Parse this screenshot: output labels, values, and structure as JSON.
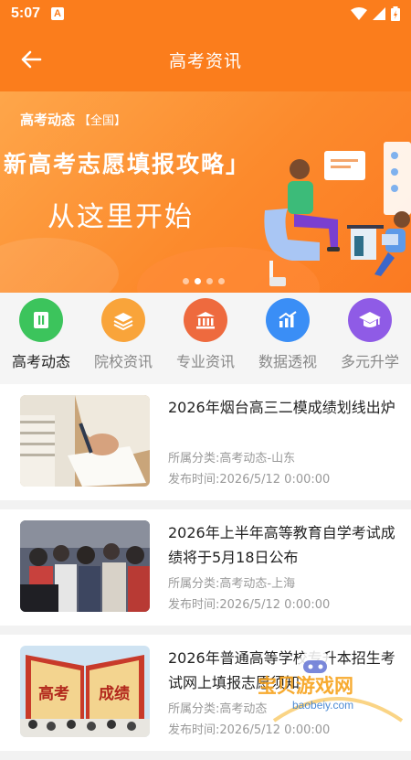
{
  "status_bar": {
    "time": "5:07",
    "badge": "A"
  },
  "header": {
    "title": "高考资讯"
  },
  "banner": {
    "tag": "高考动态",
    "tag_sub": "【全国】",
    "line1": "新高考志愿填报攻略」",
    "line2": "从这里开始",
    "slide_count": 4,
    "active_slide": 1
  },
  "categories": [
    {
      "label": "高考动态",
      "icon": "document-icon",
      "color": "#3cc45c",
      "active": true
    },
    {
      "label": "院校资讯",
      "icon": "books-icon",
      "color": "#f9a43a",
      "active": false
    },
    {
      "label": "专业资讯",
      "icon": "institution-icon",
      "color": "#ee6a3e",
      "active": false
    },
    {
      "label": "数据透视",
      "icon": "chart-icon",
      "color": "#3a8ef6",
      "active": false
    },
    {
      "label": "多元升学",
      "icon": "graduation-cap-icon",
      "color": "#8f5be6",
      "active": false
    }
  ],
  "articles": [
    {
      "title": "2026年烟台高三二模成绩划线出炉",
      "category_label": "所属分类:",
      "category": "高考动态-山东",
      "time_label": "发布时间:",
      "time": "2026/5/12 0:00:00"
    },
    {
      "title": "2026年上半年高等教育自学考试成绩将于5月18日公布",
      "category_label": "所属分类:",
      "category": "高考动态-上海",
      "time_label": "发布时间:",
      "time": "2026/5/12 0:00:00"
    },
    {
      "title": "2026年普通高等学校专升本招生考试网上填报志愿须知",
      "category_label": "所属分类:",
      "category": "高考动态",
      "time_label": "发布时间:",
      "time": "2026/5/12 0:00:00"
    }
  ],
  "thumb3": {
    "left_text": "高考",
    "right_text": "成绩"
  },
  "watermark": {
    "text": "宝贝游戏网",
    "url": "baobeiy.com"
  }
}
